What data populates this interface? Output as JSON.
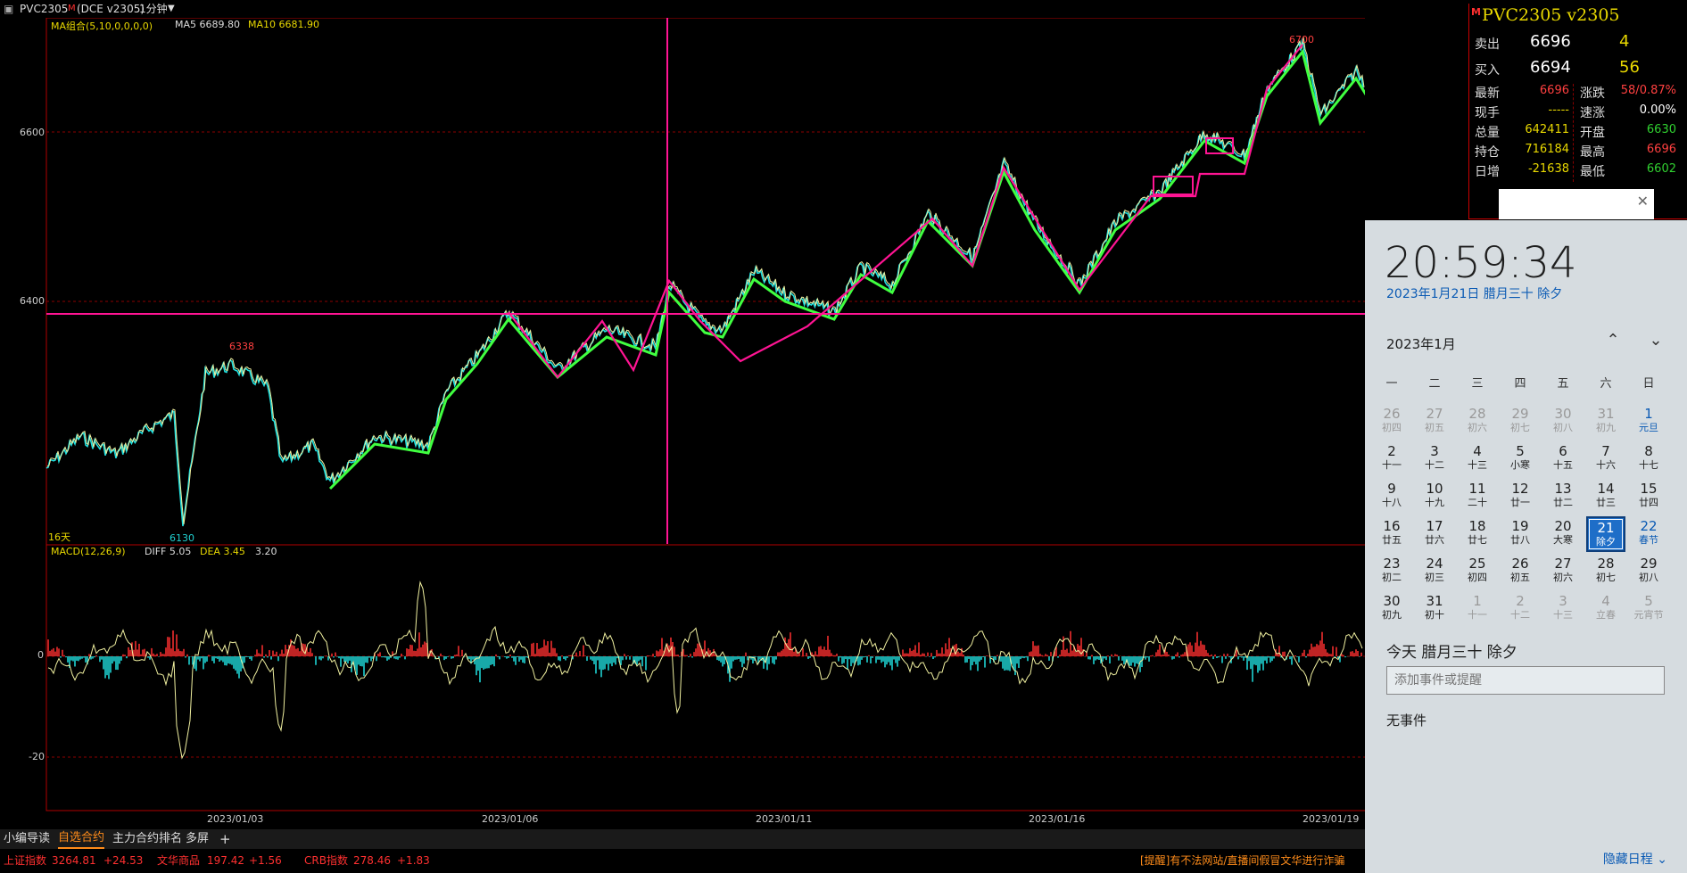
{
  "window": {
    "symbol_label": "PVC2305",
    "symbol_flag": "M",
    "exchange_label": "(DCE v2305)",
    "period_label": "1分钟"
  },
  "indicators": {
    "ma_label": "MA组合(5,10,0,0,0,0)",
    "ma5": "MA5 6689.80",
    "ma10": "MA10 6681.90",
    "macd_label": "MACD(12,26,9)",
    "diff": "DIFF 5.05",
    "dea": "DEA 3.45",
    "macd_val": "3.20",
    "days_label": "16天"
  },
  "price_axis": {
    "ticks": [
      "6600",
      "6400"
    ],
    "high_marker": "6700",
    "mid_marker": "6338",
    "low_marker": "6130"
  },
  "macd_axis": {
    "ticks": [
      "0",
      "-20"
    ]
  },
  "time_axis": {
    "ticks": [
      "2023/01/03",
      "2023/01/06",
      "2023/01/11",
      "2023/01/16",
      "2023/01/19"
    ]
  },
  "quote": {
    "flag": "M",
    "title": "PVC2305  v2305",
    "sell_label": "卖出",
    "sell_price": "6696",
    "sell_vol": "4",
    "buy_label": "买入",
    "buy_price": "6694",
    "buy_vol": "56",
    "rows": [
      {
        "l1": "最新",
        "v1": "6696",
        "c1": "#ff4040",
        "l2": "涨跌",
        "v2": "58/0.87%",
        "c2": "#ff4040"
      },
      {
        "l1": "现手",
        "v1": "-----",
        "c1": "#e8d800",
        "l2": "速涨",
        "v2": "0.00%",
        "c2": "#ffffff"
      },
      {
        "l1": "总量",
        "v1": "642411",
        "c1": "#e8d800",
        "l2": "开盘",
        "v2": "6630",
        "c2": "#30d030"
      },
      {
        "l1": "持仓",
        "v1": "716184",
        "c1": "#e8d800",
        "l2": "最高",
        "v2": "6696",
        "c2": "#ff4040"
      },
      {
        "l1": "日增",
        "v1": "-21638",
        "c1": "#e8d800",
        "l2": "最低",
        "v2": "6602",
        "c2": "#30d030"
      }
    ]
  },
  "calendar": {
    "clock": "20:59:34",
    "date_line": "2023年1月21日 腊月三十 除夕",
    "month_label": "2023年1月",
    "weekdays": [
      "一",
      "二",
      "三",
      "四",
      "五",
      "六",
      "日"
    ],
    "days": [
      {
        "n": "26",
        "l": "初四",
        "other": true
      },
      {
        "n": "27",
        "l": "初五",
        "other": true
      },
      {
        "n": "28",
        "l": "初六",
        "other": true
      },
      {
        "n": "29",
        "l": "初七",
        "other": true
      },
      {
        "n": "30",
        "l": "初八",
        "other": true
      },
      {
        "n": "31",
        "l": "初九",
        "other": true
      },
      {
        "n": "1",
        "l": "元旦",
        "holiday": true
      },
      {
        "n": "2",
        "l": "十一"
      },
      {
        "n": "3",
        "l": "十二"
      },
      {
        "n": "4",
        "l": "十三"
      },
      {
        "n": "5",
        "l": "小寒"
      },
      {
        "n": "6",
        "l": "十五"
      },
      {
        "n": "7",
        "l": "十六"
      },
      {
        "n": "8",
        "l": "十七"
      },
      {
        "n": "9",
        "l": "十八"
      },
      {
        "n": "10",
        "l": "十九"
      },
      {
        "n": "11",
        "l": "二十"
      },
      {
        "n": "12",
        "l": "廿一"
      },
      {
        "n": "13",
        "l": "廿二"
      },
      {
        "n": "14",
        "l": "廿三"
      },
      {
        "n": "15",
        "l": "廿四"
      },
      {
        "n": "16",
        "l": "廿五"
      },
      {
        "n": "17",
        "l": "廿六"
      },
      {
        "n": "18",
        "l": "廿七"
      },
      {
        "n": "19",
        "l": "廿八"
      },
      {
        "n": "20",
        "l": "大寒"
      },
      {
        "n": "21",
        "l": "除夕",
        "today": true
      },
      {
        "n": "22",
        "l": "春节",
        "holiday": true
      },
      {
        "n": "23",
        "l": "初二"
      },
      {
        "n": "24",
        "l": "初三"
      },
      {
        "n": "25",
        "l": "初四"
      },
      {
        "n": "26",
        "l": "初五"
      },
      {
        "n": "27",
        "l": "初六"
      },
      {
        "n": "28",
        "l": "初七"
      },
      {
        "n": "29",
        "l": "初八"
      },
      {
        "n": "30",
        "l": "初九"
      },
      {
        "n": "31",
        "l": "初十"
      },
      {
        "n": "1",
        "l": "十一",
        "other": true
      },
      {
        "n": "2",
        "l": "十二",
        "other": true
      },
      {
        "n": "3",
        "l": "十三",
        "other": true
      },
      {
        "n": "4",
        "l": "立春",
        "other": true
      },
      {
        "n": "5",
        "l": "元宵节",
        "other": true
      }
    ],
    "today_title": "今天 腊月三十 除夕",
    "event_placeholder": "添加事件或提醒",
    "no_events": "无事件",
    "hide_label": "隐藏日程"
  },
  "tabs": [
    "小编导读",
    "自选合约",
    "主力合约排名",
    "多屏",
    "+"
  ],
  "status": {
    "idx1_name": "上证指数",
    "idx1_val": "3264.81",
    "idx1_chg": "+24.53",
    "idx2_name": "文华商品",
    "idx2_val": "197.42",
    "idx2_chg": "+1.56",
    "idx3_name": "CRB指数",
    "idx3_val": "278.46",
    "idx3_chg": "+1.83",
    "notice": "[提醒]有不法网站/直播间假冒文华进行诈骗"
  },
  "colors": {
    "up": "#ff3030",
    "down": "#20e0e0",
    "ma5": "#f0f0a0",
    "zigzag": "#ff1493",
    "trend": "#40ff40",
    "grid": "#8b0000"
  }
}
